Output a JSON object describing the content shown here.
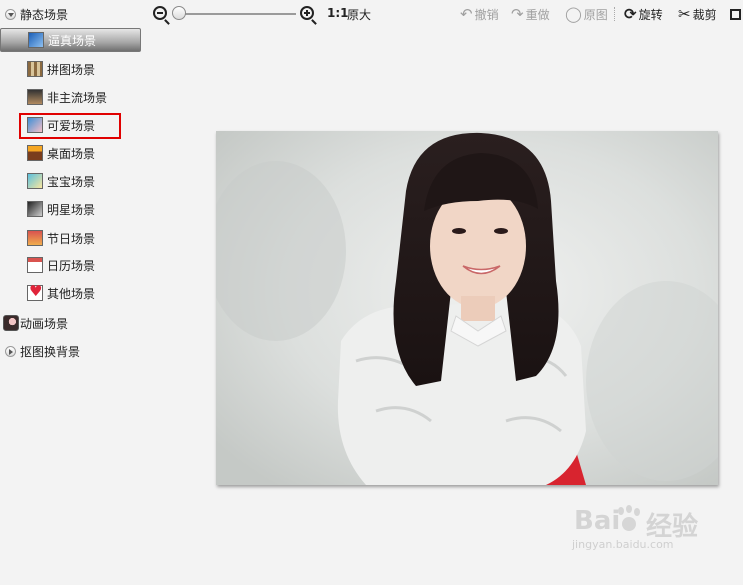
{
  "sidebar": {
    "groups": [
      {
        "label": "静态场景",
        "expanded": true
      },
      {
        "label": "动画场景"
      },
      {
        "label": "抠图换背景",
        "expanded": false
      }
    ],
    "items": [
      {
        "label": "逼真场景",
        "icon": "realistic-scene-icon",
        "active": true
      },
      {
        "label": "拼图场景",
        "icon": "puzzle-scene-icon"
      },
      {
        "label": "非主流场景",
        "icon": "alternative-scene-icon"
      },
      {
        "label": "可爱场景",
        "icon": "cute-scene-icon",
        "highlighted": true
      },
      {
        "label": "桌面场景",
        "icon": "desktop-scene-icon"
      },
      {
        "label": "宝宝场景",
        "icon": "baby-scene-icon"
      },
      {
        "label": "明星场景",
        "icon": "star-scene-icon"
      },
      {
        "label": "节日场景",
        "icon": "festival-scene-icon"
      },
      {
        "label": "日历场景",
        "icon": "calendar-scene-icon"
      },
      {
        "label": "其他场景",
        "icon": "heart-icon"
      }
    ]
  },
  "toolbar": {
    "zoom": {
      "level": 0.0,
      "ratio_label": "1:1",
      "original_size_label": "原大"
    },
    "undo_label": "撤销",
    "redo_label": "重做",
    "original_label": "原图",
    "rotate_label": "旋转",
    "crop_label": "裁剪"
  },
  "watermark": {
    "brand_left": "Bai",
    "brand_right": "经验",
    "url": "jingyan.baidu.com"
  },
  "colors": {
    "highlight_border": "#e00000",
    "active_item_gradient_end": "#6f6f6f"
  }
}
